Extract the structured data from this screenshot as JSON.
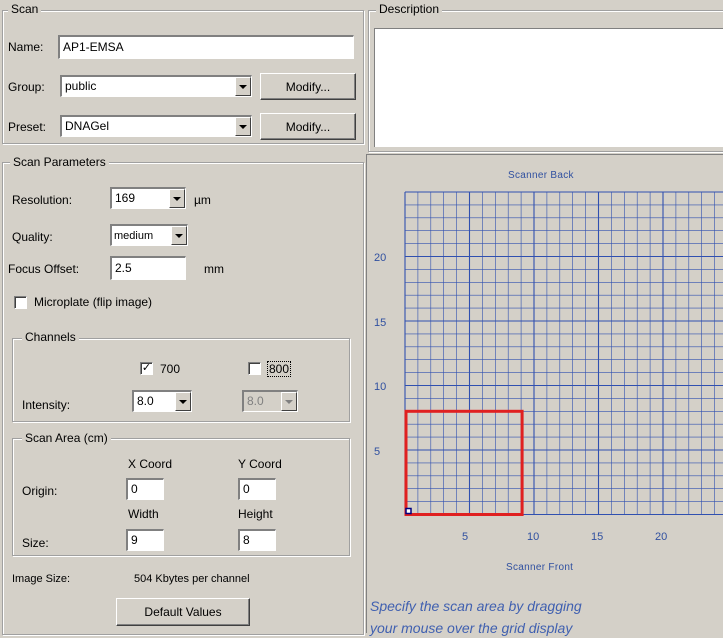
{
  "scan": {
    "legend": "Scan",
    "name_label": "Name:",
    "name_value": "AP1-EMSA",
    "group_label": "Group:",
    "group_value": "public",
    "preset_label": "Preset:",
    "preset_value": "DNAGel",
    "modify_label": "Modify..."
  },
  "description": {
    "legend": "Description",
    "text": ""
  },
  "params": {
    "legend": "Scan Parameters",
    "resolution_label": "Resolution:",
    "resolution_value": "169",
    "resolution_unit": "µm",
    "quality_label": "Quality:",
    "quality_value": "medium",
    "focus_label": "Focus Offset:",
    "focus_value": "2.5",
    "focus_unit": "mm",
    "microplate_label": "Microplate (flip image)",
    "microplate_checked": false
  },
  "channels": {
    "legend": "Channels",
    "ch700_label": "700",
    "ch700_checked": true,
    "ch800_label": "800",
    "ch800_checked": false,
    "intensity_label": "Intensity:",
    "intensity_700": "8.0",
    "intensity_800": "8.0"
  },
  "area": {
    "legend": "Scan Area (cm)",
    "xcoord_label": "X Coord",
    "ycoord_label": "Y Coord",
    "origin_label": "Origin:",
    "origin_x": "0",
    "origin_y": "0",
    "width_label": "Width",
    "height_label": "Height",
    "size_label": "Size:",
    "width_value": "9",
    "height_value": "8"
  },
  "image_size": {
    "label": "Image Size:",
    "value": "504 Kbytes per channel"
  },
  "default_button": "Default Values",
  "grid": {
    "back_label": "Scanner Back",
    "front_label": "Scanner Front",
    "x_ticks": [
      "5",
      "10",
      "15",
      "20"
    ],
    "y_ticks": [
      "20",
      "15",
      "10",
      "5"
    ],
    "selection_color": "#e02020",
    "grid_color": "#3050b0"
  },
  "hint": {
    "line1": "Specify the scan area by dragging",
    "line2": "your mouse over the grid display"
  }
}
